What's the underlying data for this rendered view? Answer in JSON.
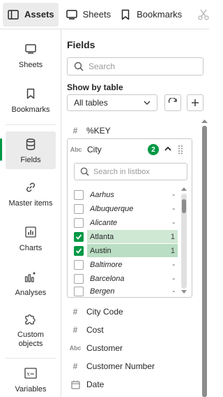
{
  "toolbar": {
    "assets_label": "Assets",
    "sheets_label": "Sheets",
    "bookmarks_label": "Bookmarks"
  },
  "nav": {
    "items": [
      {
        "label": "Sheets"
      },
      {
        "label": "Bookmarks"
      },
      {
        "label": "Fields"
      },
      {
        "label": "Master items"
      },
      {
        "label": "Charts"
      },
      {
        "label": "Analyses"
      },
      {
        "label": "Custom objects"
      },
      {
        "label": "Variables"
      }
    ],
    "active": "Fields"
  },
  "panel": {
    "title": "Fields",
    "search_placeholder": "Search",
    "show_by_table_label": "Show by table",
    "table_select_value": "All tables"
  },
  "fields_above": [
    {
      "type": "#",
      "name": "%KEY"
    }
  ],
  "city_card": {
    "type": "Abc",
    "name": "City",
    "selected_count": "2",
    "listbox_search_placeholder": "Search in listbox",
    "values": [
      {
        "name": "Aarhus",
        "count": "-",
        "selected": false
      },
      {
        "name": "Albuquerque",
        "count": "-",
        "selected": false
      },
      {
        "name": "Alicante",
        "count": "-",
        "selected": false
      },
      {
        "name": "Atlanta",
        "count": "1",
        "selected": true
      },
      {
        "name": "Austin",
        "count": "1",
        "selected": true
      },
      {
        "name": "Baltimore",
        "count": "-",
        "selected": false
      },
      {
        "name": "Barcelona",
        "count": "-",
        "selected": false
      },
      {
        "name": "Bergen",
        "count": "-",
        "selected": false
      }
    ]
  },
  "fields_below": [
    {
      "type": "#",
      "name": "City Code"
    },
    {
      "type": "#",
      "name": "Cost"
    },
    {
      "type": "Abc",
      "name": "Customer"
    },
    {
      "type": "#",
      "name": "Customer Number"
    },
    {
      "type": "date",
      "name": "Date"
    }
  ],
  "colors": {
    "accent_green": "#009845",
    "selected_row": "#cfe8d4"
  }
}
